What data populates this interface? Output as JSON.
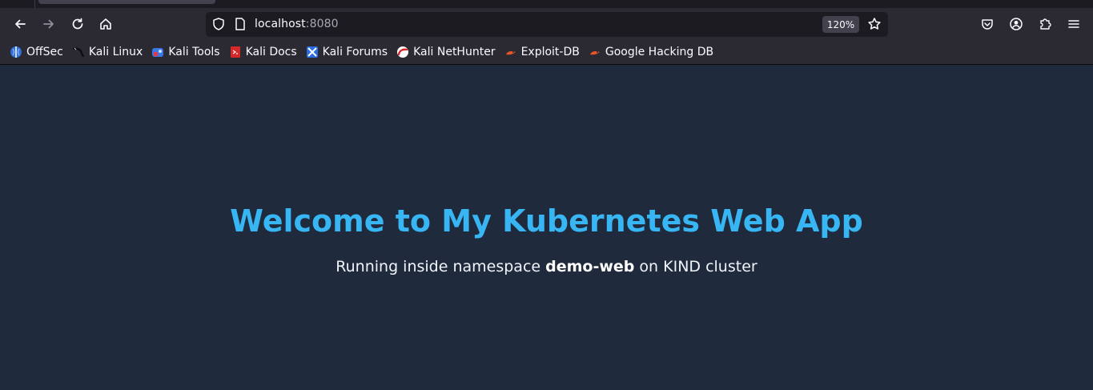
{
  "browser": {
    "url_host": "localhost",
    "url_port": ":8080",
    "zoom": "120%",
    "bookmarks": [
      {
        "label": "OffSec",
        "icon": "offsec-icon"
      },
      {
        "label": "Kali Linux",
        "icon": "kali-dragon-icon"
      },
      {
        "label": "Kali Tools",
        "icon": "kali-tools-icon"
      },
      {
        "label": "Kali Docs",
        "icon": "kali-docs-icon"
      },
      {
        "label": "Kali Forums",
        "icon": "kali-forums-icon"
      },
      {
        "label": "Kali NetHunter",
        "icon": "nethunter-icon"
      },
      {
        "label": "Exploit-DB",
        "icon": "exploit-db-icon"
      },
      {
        "label": "Google Hacking DB",
        "icon": "ghdb-icon"
      }
    ]
  },
  "page": {
    "title": "Welcome to My Kubernetes Web App",
    "subtitle_prefix": "Running inside namespace ",
    "namespace": "demo-web",
    "subtitle_suffix": " on KIND cluster"
  },
  "colors": {
    "background": "#1f2a3d",
    "heading": "#38b6f4",
    "chrome": "#2b2a33",
    "urlbar": "#1c1b22"
  }
}
